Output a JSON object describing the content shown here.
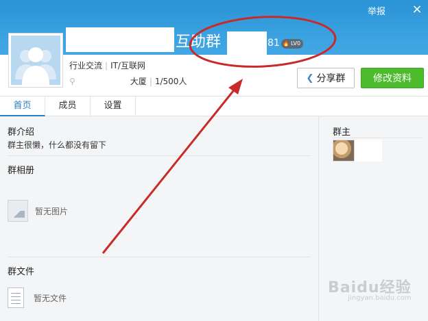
{
  "window": {
    "report_label": "举报",
    "close_glyph": "×"
  },
  "group": {
    "title": "互助群",
    "id_tail": "81",
    "level": "LV0",
    "tags": [
      "行业交流",
      "IT/互联网"
    ],
    "location": "大厦",
    "members": "1/500人"
  },
  "actions": {
    "share_label": "分享群",
    "edit_label": "修改资料"
  },
  "tabs": [
    {
      "label": "首页"
    },
    {
      "label": "成员"
    },
    {
      "label": "设置"
    }
  ],
  "sections": {
    "intro": {
      "title": "群介绍",
      "text": "群主很懒，什么都没有留下"
    },
    "album": {
      "title": "群相册",
      "empty": "暂无图片"
    },
    "files": {
      "title": "群文件",
      "empty": "暂无文件"
    }
  },
  "side": {
    "owner_title": "群主"
  },
  "watermark": {
    "text": "Baidu经验",
    "sub": "jingyan.baidu.com"
  },
  "colors": {
    "header": "#3da3e2",
    "accent": "#2a7ec2",
    "edit_button": "#4cbb2c",
    "annotation": "#c82a2a"
  }
}
